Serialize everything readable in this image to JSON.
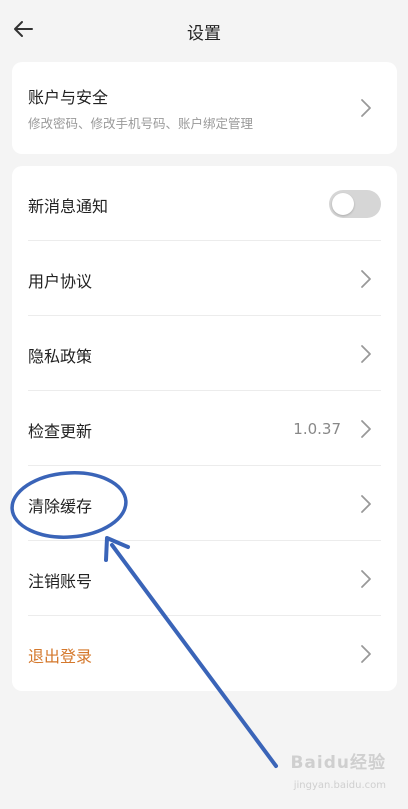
{
  "header": {
    "title": "设置"
  },
  "account": {
    "title": "账户与安全",
    "subtitle": "修改密码、修改手机号码、账户绑定管理"
  },
  "settings": {
    "notifications": {
      "label": "新消息通知",
      "enabled": false
    },
    "user_agreement": {
      "label": "用户协议"
    },
    "privacy_policy": {
      "label": "隐私政策"
    },
    "check_update": {
      "label": "检查更新",
      "version": "1.0.37"
    },
    "clear_cache": {
      "label": "清除缓存"
    },
    "cancel_account": {
      "label": "注销账号"
    },
    "logout": {
      "label": "退出登录"
    }
  },
  "watermark": {
    "brand": "Baidu经验",
    "sub": "jingyan.baidu.com"
  },
  "colors": {
    "background": "#f4f4f4",
    "card": "#ffffff",
    "logout": "#d4782c",
    "annotation": "#3a64b8",
    "toggle_off": "#d6d6d6"
  },
  "icons": [
    "back-arrow-icon",
    "chevron-right-icon",
    "toggle-switch"
  ]
}
